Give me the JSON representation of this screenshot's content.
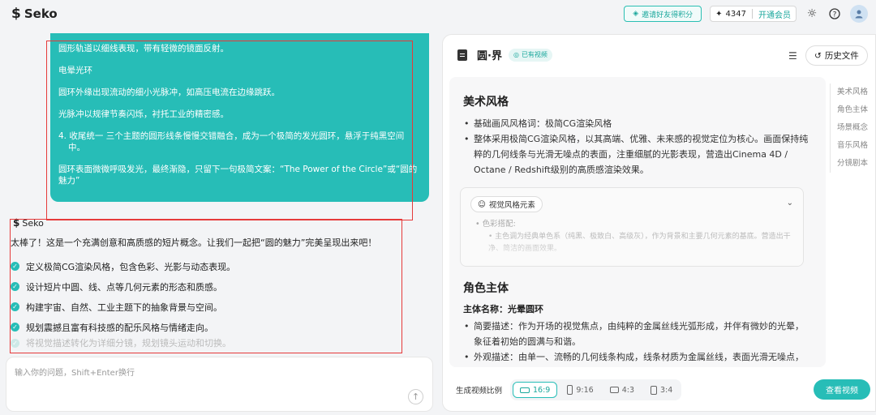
{
  "header": {
    "logo": "Seko",
    "invite_label": "邀请好友得积分",
    "credits_value": "4347",
    "member_label": "开通会员"
  },
  "chat": {
    "user_message": [
      "圆形轨道以细线表现，带有轻微的镜面反射。",
      "电晕光环",
      "圆环外缘出现流动的细小光脉冲，如高压电流在边缘跳跃。",
      "光脉冲以规律节奏闪烁，衬托工业的精密感。",
      "4. 收尾统一 三个主题的圆形线条慢慢交错融合，成为一个极简的发光圆环，悬浮于纯黑空间中。",
      "圆环表面微微呼吸发光，最终渐隐，只留下一句极简文案：“The Power of the Circle”或“圆的魅力”"
    ],
    "assistant_name": "Seko",
    "assistant_intro": "太棒了！这是一个充满创意和高质感的短片概念。让我们一起把“圆的魅力”完美呈现出来吧！",
    "assistant_steps": [
      "定义极简CG渲染风格，包含色彩、光影与动态表现。",
      "设计短片中圆、线、点等几何元素的形态和质感。",
      "构建宇宙、自然、工业主题下的抽象背景与空间。",
      "规划震撼且富有科技感的配乐风格与情绪走向。",
      "将视觉描述转化为详细分镜，规划镜头运动和切换。"
    ],
    "input_placeholder": "输入你的问题，Shift+Enter换行"
  },
  "panel": {
    "title": "圆·界",
    "badge": "已有视频",
    "history_label": "历史文件",
    "section1_title": "美术风格",
    "section1_items": [
      "基础画风风格词：极简CG渲染风格",
      "整体采用极简CG渲染风格，以其高端、优雅、未来感的视觉定位为核心。画面保持纯粹的几何线条与光滑无噪点的表面，注重细腻的光影表现，营造出Cinema 4D / Octane / Redshift级别的高质感渲染效果。"
    ],
    "card_tag": "视觉风格元素",
    "card_sub": "色彩搭配:",
    "card_sub2": "主色调为经典单色系（纯黑、极致白、高级灰），作为背景和主要几何元素的基底。营造出干净、简洁的画面效果。",
    "section2_title": "角色主体",
    "subject_label": "主体名称：光晕圆环",
    "section2_items": [
      "简要描述：作为开场的视觉焦点，由纯粹的金属丝线光弧形成，并伴有微妙的光晕，象征着初始的圆满与和谐。",
      "外观描述：由单一、流畅的几何线条构成，线条材质为金属丝线，表面光滑无噪点，"
    ],
    "toc": [
      "美术风格",
      "角色主体",
      "场景概念",
      "音乐风格",
      "分镜剧本"
    ],
    "ratio_label": "生成视频比例",
    "ratios": [
      "16:9",
      "9:16",
      "4:3",
      "3:4"
    ],
    "view_button": "查看视频"
  }
}
